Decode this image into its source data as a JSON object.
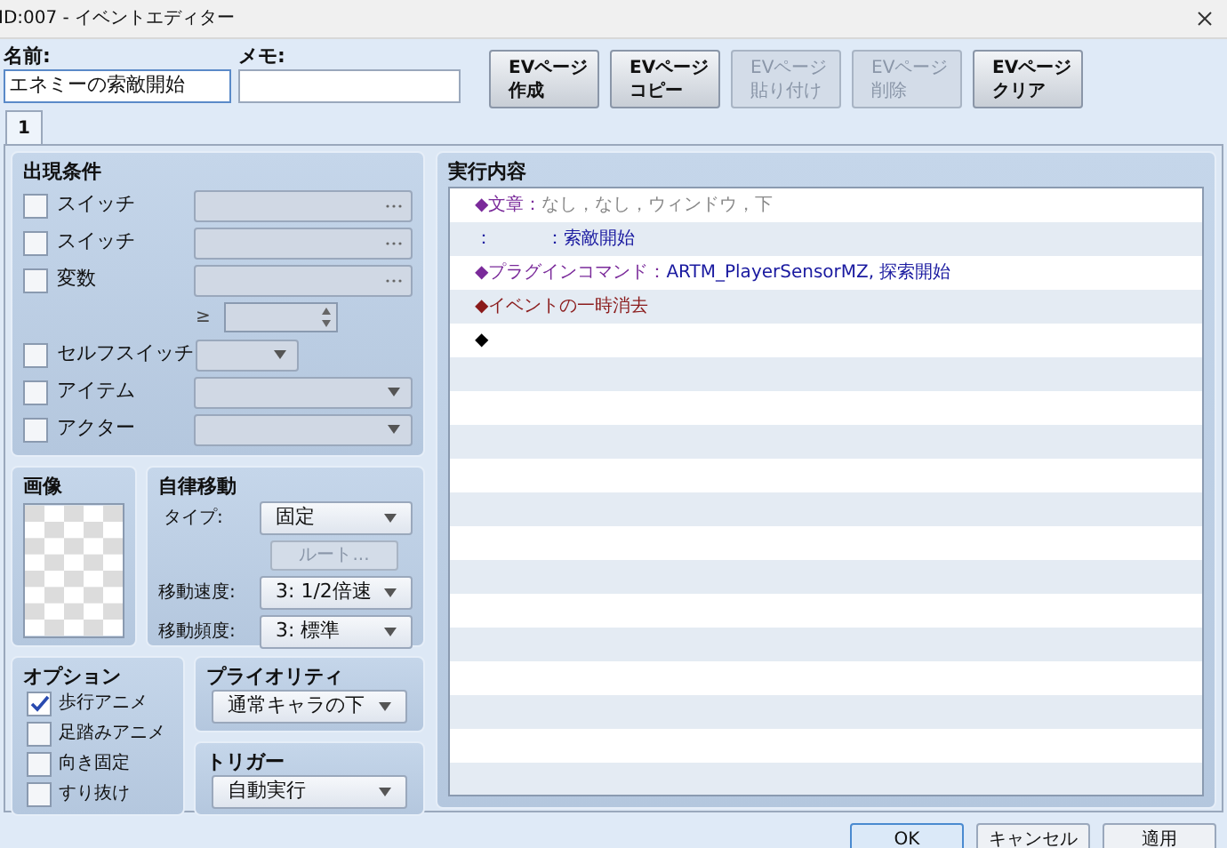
{
  "window": {
    "title": "ID:007 - イベントエディター"
  },
  "name": {
    "label": "名前:",
    "value": "エネミーの索敵開始"
  },
  "memo": {
    "label": "メモ:"
  },
  "page_buttons": [
    {
      "lines": [
        "EVページ",
        "作成"
      ],
      "disabled": false
    },
    {
      "lines": [
        "EVページ",
        "コピー"
      ],
      "disabled": false
    },
    {
      "lines": [
        "EVページ",
        "貼り付け"
      ],
      "disabled": true
    },
    {
      "lines": [
        "EVページ",
        "削除"
      ],
      "disabled": true
    },
    {
      "lines": [
        "EVページ",
        "クリア"
      ],
      "disabled": false
    }
  ],
  "tabs": [
    {
      "label": "1",
      "selected": true
    }
  ],
  "conditions": {
    "title": "出現条件",
    "rows": [
      {
        "label": "スイッチ",
        "checked": false,
        "kind": "picker"
      },
      {
        "label": "スイッチ",
        "checked": false,
        "kind": "picker"
      },
      {
        "label": "変数",
        "checked": false,
        "kind": "picker"
      },
      {
        "kind": "compare",
        "symbol": "≥"
      },
      {
        "label": "セルフスイッチ",
        "checked": false,
        "kind": "short-dropdown"
      },
      {
        "label": "アイテム",
        "checked": false,
        "kind": "dropdown"
      },
      {
        "label": "アクター",
        "checked": false,
        "kind": "dropdown"
      }
    ]
  },
  "image": {
    "title": "画像"
  },
  "movement": {
    "title": "自律移動",
    "type": {
      "label": "タイプ:",
      "value": "固定"
    },
    "route": {
      "label": "ルート...",
      "disabled": true
    },
    "speed": {
      "label": "移動速度:",
      "value": "3: 1/2倍速"
    },
    "frequency": {
      "label": "移動頻度:",
      "value": "3: 標準"
    }
  },
  "options": {
    "title": "オプション",
    "items": [
      {
        "label": "歩行アニメ",
        "checked": true
      },
      {
        "label": "足踏みアニメ",
        "checked": false
      },
      {
        "label": "向き固定",
        "checked": false
      },
      {
        "label": "すり抜け",
        "checked": false
      }
    ]
  },
  "priority": {
    "title": "プライオリティ",
    "value": "通常キャラの下"
  },
  "trigger": {
    "title": "トリガー",
    "value": "自動実行"
  },
  "contents": {
    "title": "実行内容",
    "lines": [
      {
        "kind": "text",
        "head": "◆文章：",
        "rest": "なし，なし，ウィンドウ，下"
      },
      {
        "kind": "text-body",
        "head": "：　　　：",
        "rest": "索敵開始"
      },
      {
        "kind": "plugin",
        "head": "◆プラグインコマンド：",
        "rest": "ARTM_PlayerSensorMZ, 探索開始"
      },
      {
        "kind": "erase",
        "head": "◆イベントの一時消去"
      },
      {
        "kind": "empty",
        "head": "◆"
      }
    ]
  },
  "footer_buttons": [
    {
      "label": "OK",
      "default": true
    },
    {
      "label": "キャンセル",
      "default": false
    },
    {
      "label": "適用",
      "default": false
    }
  ]
}
